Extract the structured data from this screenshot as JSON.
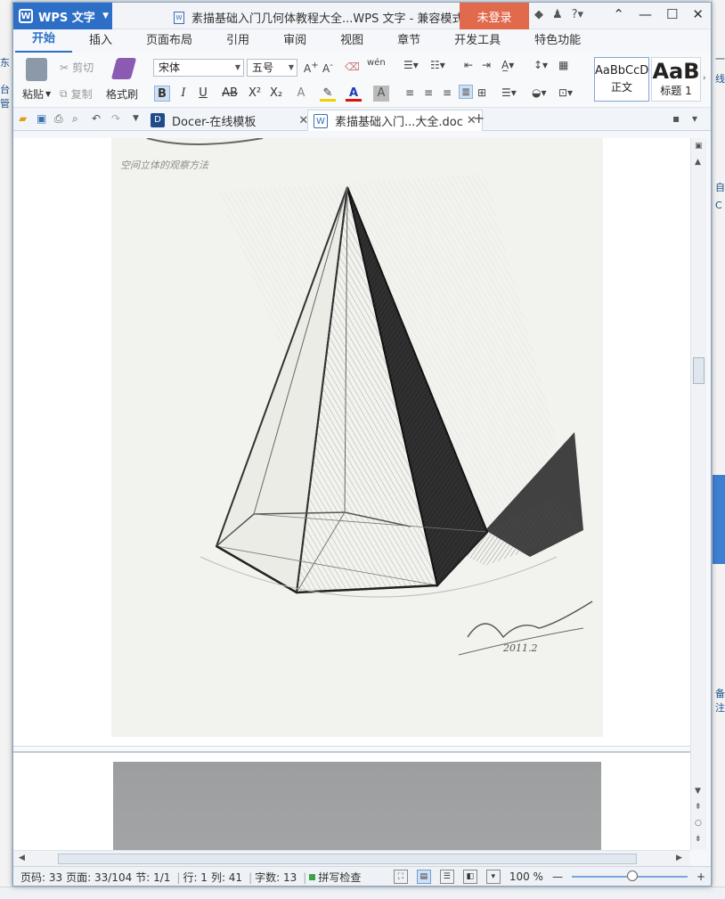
{
  "app": {
    "name": "WPS 文字",
    "window_title": "素描基础入门几何体教程大全...WPS 文字 - 兼容模式",
    "login_label": "未登录"
  },
  "ribbon_tabs": [
    "开始",
    "插入",
    "页面布局",
    "引用",
    "审阅",
    "视图",
    "章节",
    "开发工具",
    "特色功能"
  ],
  "ribbon": {
    "paste": "粘贴",
    "cut": "剪切",
    "copy": "复制",
    "format_painter": "格式刷",
    "font_name": "宋体",
    "font_size": "五号",
    "styles": [
      {
        "preview": "AaBbCcD",
        "caption": "正文"
      },
      {
        "preview": "AaB",
        "caption": "标题 1"
      }
    ]
  },
  "doc_tabs": [
    {
      "label": "Docer-在线模板",
      "icon": "docer-icon"
    },
    {
      "label": "素描基础入门...大全.doc",
      "icon": "doc-icon"
    }
  ],
  "document": {
    "sketch_caption": "空间立体的观察方法",
    "signature": "2011.2"
  },
  "background_app": {
    "left_labels": [
      "东",
      "台管"
    ],
    "right_labels": [
      "一",
      "线",
      "自",
      "C",
      "备注"
    ]
  },
  "statusbar": {
    "page_num": "页码: 33",
    "page_count": "页面: 33/104",
    "section": "节: 1/1",
    "row": "行: 1",
    "col": "列: 41",
    "word_count": "字数: 13",
    "spell_check": "拼写检查",
    "zoom": "100 %"
  },
  "colors": {
    "app_blue": "#2d6fc6",
    "login_red": "#e06a4b",
    "accent_blue": "#2b6fc7"
  }
}
